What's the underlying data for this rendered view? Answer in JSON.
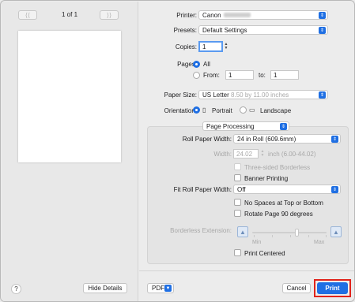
{
  "nav": {
    "prev_icon": "double-chevron-left",
    "next_icon": "double-chevron-right",
    "page_counter": "1 of 1"
  },
  "left": {
    "help_label": "?",
    "hide_details_label": "Hide Details"
  },
  "printer": {
    "label": "Printer:",
    "value": "Canon"
  },
  "presets": {
    "label": "Presets:",
    "value": "Default Settings"
  },
  "copies": {
    "label": "Copies:",
    "value": "1"
  },
  "pages": {
    "label": "Pages:",
    "all_label": "All",
    "from_label": "From:",
    "from_value": "1",
    "to_label": "to:",
    "to_value": "1"
  },
  "paper_size": {
    "label": "Paper Size:",
    "value": "US Letter",
    "dims": "8.50 by 11.00 inches"
  },
  "orientation": {
    "label": "Orientation:",
    "portrait_label": "Portrait",
    "landscape_label": "Landscape"
  },
  "section_popup": {
    "value": "Page Processing"
  },
  "roll_width": {
    "label": "Roll Paper Width:",
    "value": "24 in Roll (609.6mm)"
  },
  "width": {
    "label": "Width:",
    "value": "24.02",
    "unit": "inch (6.00-44.02)"
  },
  "checkboxes": {
    "three_sided": "Three-sided Borderless",
    "banner": "Banner Printing",
    "no_spaces": "No Spaces at Top or Bottom",
    "rotate": "Rotate Page 90 degrees",
    "centered": "Print Centered"
  },
  "fit_roll": {
    "label": "Fit Roll Paper Width:",
    "value": "Off"
  },
  "borderless_ext": {
    "label": "Borderless Extension:",
    "min_label": "Min",
    "max_label": "Max"
  },
  "footer": {
    "pdf_label": "PDF",
    "cancel_label": "Cancel",
    "print_label": "Print"
  },
  "colors": {
    "accent": "#1f6fe3",
    "highlight": "#e0231b"
  }
}
